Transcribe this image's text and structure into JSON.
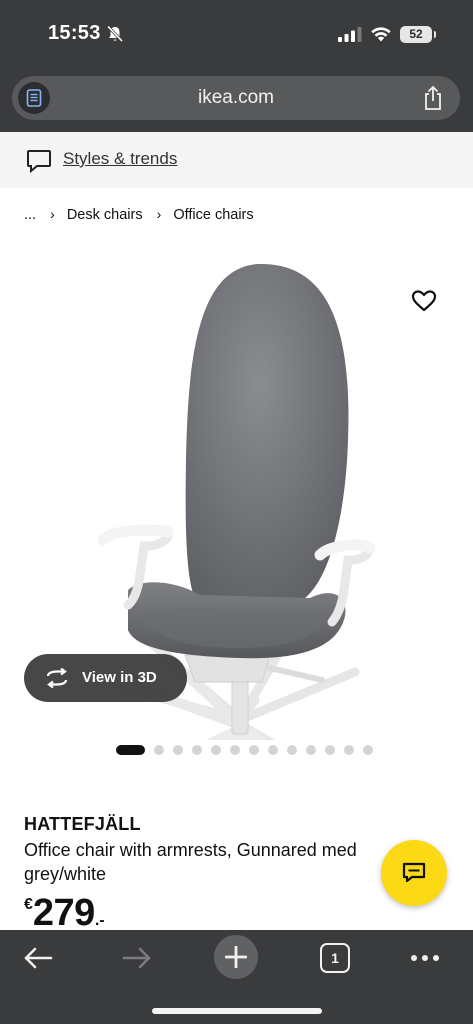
{
  "status_bar": {
    "time": "15:53",
    "battery": "52",
    "icons": [
      "bell-muted-icon",
      "signal-icon",
      "wifi-icon",
      "battery-icon"
    ]
  },
  "browser": {
    "url": "ikea.com",
    "icons": [
      "reader-icon",
      "share-icon"
    ]
  },
  "top_bar": {
    "styles_link": "Styles & trends",
    "icon": "chat-bubble-icon"
  },
  "breadcrumb": {
    "ellipsis": "...",
    "items": [
      "Desk chairs",
      "Office chairs"
    ],
    "separator": "›"
  },
  "gallery": {
    "view_3d_label": "View in 3D",
    "image_count": 13,
    "active_index": 0,
    "icons": [
      "heart-icon",
      "rotate-3d-icon"
    ]
  },
  "product": {
    "name": "HATTEFJÄLL",
    "description_line1": "Office chair with armrests, Gunnared med",
    "description_line2": "grey/white",
    "price_currency": "€",
    "price_amount": "279",
    "price_decimals": ".-"
  },
  "toolbar": {
    "tab_count": "1",
    "icons": [
      "back-arrow-icon",
      "forward-arrow-icon",
      "plus-icon",
      "tabs-icon",
      "more-icon"
    ]
  },
  "colors": {
    "browser_chrome": "#3a3b3c",
    "url_pill": "#58595b",
    "chat_fab": "#fbd914",
    "text": "#111111"
  }
}
